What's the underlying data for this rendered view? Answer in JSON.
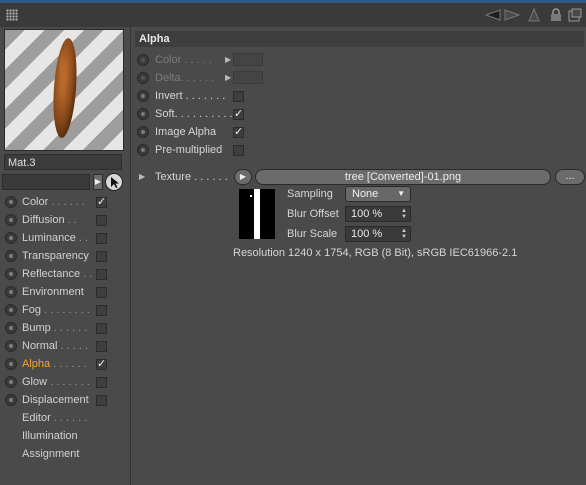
{
  "toolbar": {
    "icons": [
      "grip-icon",
      "back-arrow-icon",
      "forward-arrow-icon",
      "up-arrow-icon",
      "lock-icon",
      "new-window-icon"
    ]
  },
  "material": {
    "name": "Mat.3"
  },
  "channels": [
    {
      "label": "Color",
      "dots": " . . . . . .",
      "checked": "✓",
      "active": false,
      "has_checkbox": true
    },
    {
      "label": "Diffusion",
      "dots": " . .",
      "checked": "",
      "active": false,
      "has_checkbox": true
    },
    {
      "label": "Luminance",
      "dots": " . .",
      "checked": "",
      "active": false,
      "has_checkbox": true
    },
    {
      "label": "Transparency",
      "dots": "",
      "checked": "",
      "active": false,
      "has_checkbox": true
    },
    {
      "label": "Reflectance",
      "dots": " . .",
      "checked": "",
      "active": false,
      "has_checkbox": true
    },
    {
      "label": "Environment",
      "dots": "",
      "checked": "",
      "active": false,
      "has_checkbox": true
    },
    {
      "label": "Fog",
      "dots": " . . . . . . . .",
      "checked": "",
      "active": false,
      "has_checkbox": true
    },
    {
      "label": "Bump",
      "dots": " . . . . . .",
      "checked": "",
      "active": false,
      "has_checkbox": true
    },
    {
      "label": "Normal",
      "dots": " . . . . .",
      "checked": "",
      "active": false,
      "has_checkbox": true
    },
    {
      "label": "Alpha",
      "dots": " . . . . . .",
      "checked": "✓",
      "active": true,
      "has_checkbox": true
    },
    {
      "label": "Glow",
      "dots": " . . . . . . .",
      "checked": "",
      "active": false,
      "has_checkbox": true
    },
    {
      "label": "Displacement",
      "dots": "",
      "checked": "",
      "active": false,
      "has_checkbox": true
    },
    {
      "label": "Editor",
      "dots": " . . . . . .",
      "checked": "",
      "active": false,
      "has_checkbox": false
    },
    {
      "label": "Illumination",
      "dots": "",
      "checked": "",
      "active": false,
      "has_checkbox": false
    },
    {
      "label": "Assignment",
      "dots": "",
      "checked": "",
      "active": false,
      "has_checkbox": false
    }
  ],
  "alpha": {
    "section_title": "Alpha",
    "color_label": "Color . . . . .",
    "delta_label": "Delta. . . . . .",
    "invert_label": "Invert . . . . . . .",
    "invert_checked": "",
    "soft_label": "Soft. . . . . . . . . .",
    "soft_checked": "✓",
    "image_alpha_label": "Image Alpha",
    "image_alpha_checked": "✓",
    "premultiplied_label": "Pre-multiplied",
    "premultiplied_checked": "",
    "texture_label": "Texture . . . . . .",
    "texture_path": "tree [Converted]-01.png",
    "more_button": "...",
    "sampling_label": "Sampling",
    "sampling_value": "None",
    "blur_offset_label": "Blur Offset",
    "blur_offset_value": "100 %",
    "blur_scale_label": "Blur Scale",
    "blur_scale_value": "100 %",
    "resolution_info": "Resolution 1240 x 1754, RGB (8 Bit), sRGB IEC61966-2.1"
  }
}
